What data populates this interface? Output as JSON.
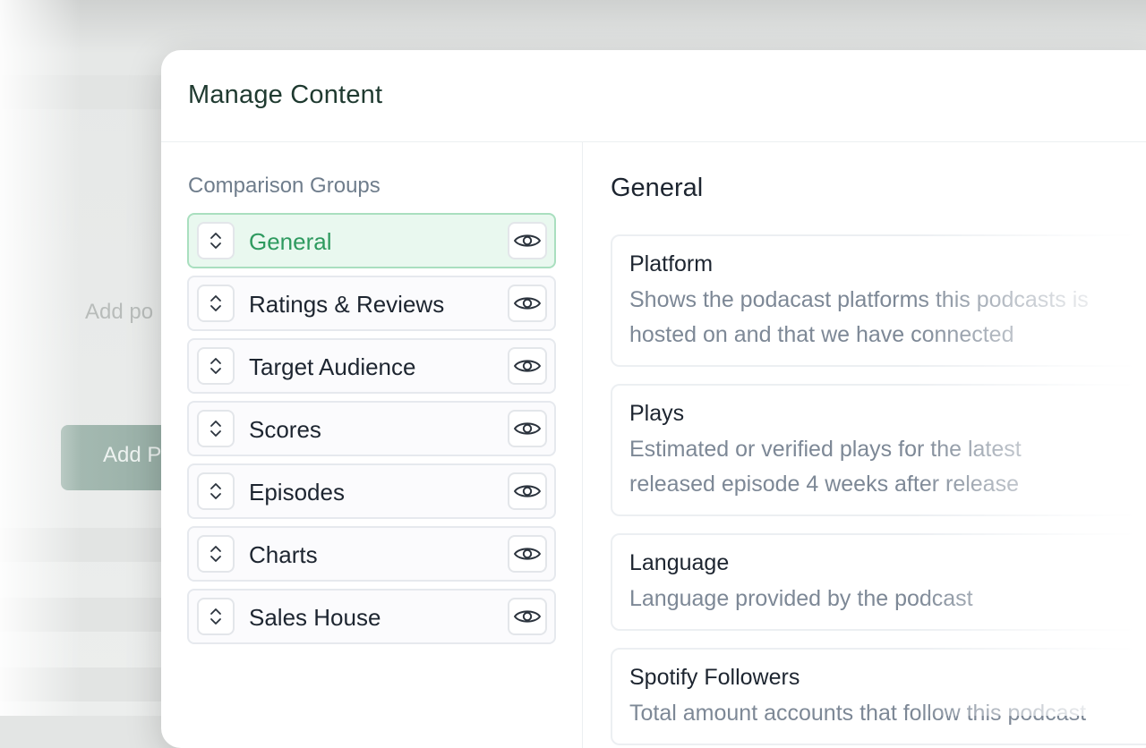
{
  "background": {
    "partial_text": "Add po",
    "partial_button": "Add P"
  },
  "modal": {
    "title": "Manage Content",
    "groups_label": "Comparison Groups",
    "groups": [
      {
        "label": "General",
        "active": true
      },
      {
        "label": "Ratings & Reviews",
        "active": false
      },
      {
        "label": "Target Audience",
        "active": false
      },
      {
        "label": "Scores",
        "active": false
      },
      {
        "label": "Episodes",
        "active": false
      },
      {
        "label": "Charts",
        "active": false
      },
      {
        "label": "Sales House",
        "active": false
      }
    ],
    "section_title": "General",
    "items": [
      {
        "title": "Platform",
        "description": "Shows the podacast platforms this podcasts is hosted on and that we have connected"
      },
      {
        "title": "Plays",
        "description": "Estimated or verified plays for the latest released episode 4 weeks after release"
      },
      {
        "title": "Language",
        "description": "Language provided by the podcast"
      },
      {
        "title": "Spotify Followers",
        "description": "Total amount accounts that follow this podcast"
      }
    ]
  },
  "icons": {
    "drag": "chevron-up-down-icon",
    "visibility": "eye-icon"
  },
  "colors": {
    "accent": "#2e9a5f",
    "active_bg": "#e9f8ef",
    "title": "#1f3a30"
  }
}
